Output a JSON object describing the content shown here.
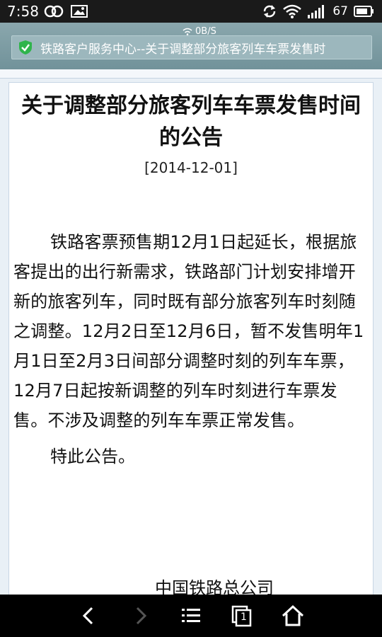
{
  "status_bar": {
    "time": "7:58",
    "battery": "67",
    "icons": [
      "link-icon",
      "image-icon",
      "sync-icon",
      "wifi-icon",
      "signal-icon",
      "battery-icon"
    ]
  },
  "browser": {
    "net_speed": "0B/S",
    "url_text": "铁路客户服务中心--关于调整部分旅客列车车票发售时"
  },
  "article": {
    "title": "关于调整部分旅客列车车票发售时间的公告",
    "date": "[2014-12-01]",
    "body": "铁路客票预售期12月1日起延长，根据旅客提出的出行新需求，铁路部门计划安排增开新的旅客列车，同时既有部分旅客列车时刻随之调整。12月2日至12月6日，暂不发售明年1月1日至2月3日间部分调整时刻的列车车票，12月7日起按新调整的列车时刻进行车票发售。不涉及调整的列车车票正常发售。",
    "closing": "特此公告。",
    "signature": "中国铁路总公司"
  },
  "nav_bar": {
    "tab_count": "1",
    "buttons": [
      "back-icon",
      "forward-icon",
      "menu-icon",
      "tabs-icon",
      "home-icon"
    ]
  }
}
